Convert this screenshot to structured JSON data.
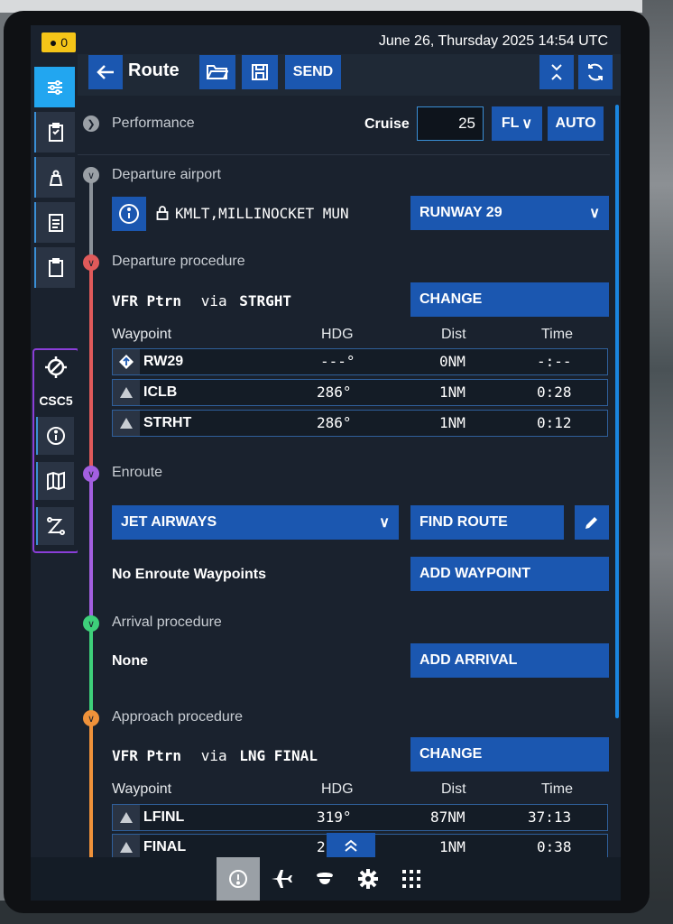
{
  "notification": {
    "count": "0"
  },
  "datetime": "June 26, Thursday 2025 14:54 UTC",
  "header": {
    "title": "Route",
    "send_label": "SEND"
  },
  "performance": {
    "label": "Performance",
    "cruise_label": "Cruise",
    "cruise_value": "25",
    "unit": "FL",
    "auto_label": "AUTO"
  },
  "departure_airport": {
    "label": "Departure airport",
    "airport": "KMLT,MILLINOCKET MUN",
    "runway": "RUNWAY 29"
  },
  "departure_procedure": {
    "label": "Departure procedure",
    "procedure": "VFR Ptrn",
    "via": "via",
    "via_value": "STRGHT",
    "change_label": "CHANGE",
    "columns": [
      "Waypoint",
      "HDG",
      "Dist",
      "Time"
    ],
    "rows": [
      {
        "icon": "runway-icon",
        "name": "RW29",
        "hdg": "---°",
        "dist": "0NM",
        "time": "-:--"
      },
      {
        "icon": "waypoint-triangle-icon",
        "name": "ICLB",
        "hdg": "286°",
        "dist": "1NM",
        "time": "0:28"
      },
      {
        "icon": "waypoint-triangle-icon",
        "name": "STRHT",
        "hdg": "286°",
        "dist": "1NM",
        "time": "0:12"
      }
    ]
  },
  "enroute": {
    "label": "Enroute",
    "airways_label": "JET AIRWAYS",
    "find_route_label": "FIND ROUTE",
    "empty_text": "No Enroute Waypoints",
    "add_waypoint_label": "ADD WAYPOINT"
  },
  "arrival": {
    "label": "Arrival procedure",
    "value": "None",
    "add_arrival_label": "ADD ARRIVAL"
  },
  "approach": {
    "label": "Approach procedure",
    "procedure": "VFR Ptrn",
    "via": "via",
    "via_value": "LNG FINAL",
    "change_label": "CHANGE",
    "columns": [
      "Waypoint",
      "HDG",
      "Dist",
      "Time"
    ],
    "rows": [
      {
        "icon": "waypoint-triangle-icon",
        "name": "LFINL",
        "hdg": "319°",
        "dist": "87NM",
        "time": "37:13"
      },
      {
        "icon": "waypoint-triangle-icon",
        "name": "FINAL",
        "hdg": "2",
        "dist": "1NM",
        "time": "0:38"
      }
    ]
  },
  "sidebar": {
    "aircraft_label": "CSC5"
  },
  "colors": {
    "accent": "#1b57b0",
    "active": "#22a6f0",
    "departure": "#e05a5a",
    "enroute": "#a35fe0",
    "arrival": "#3ed07a",
    "approach": "#f0923a",
    "airport": "#8b929a"
  }
}
